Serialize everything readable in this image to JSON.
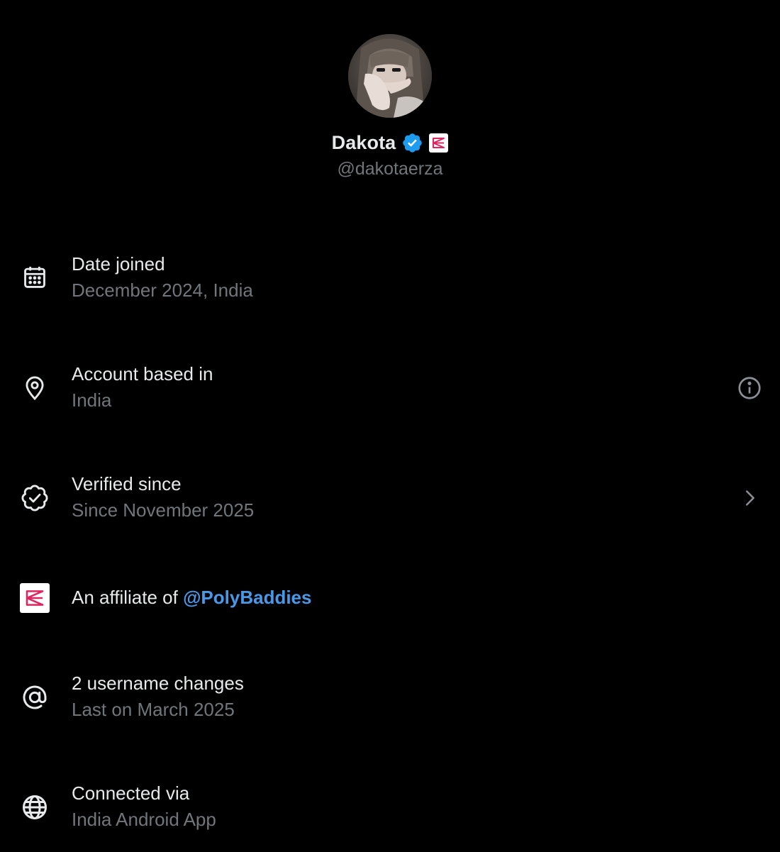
{
  "profile": {
    "display_name": "Dakota",
    "handle": "@dakotaerza",
    "avatar_icon": "avatar-photo",
    "verified_color": "#1d9bf0",
    "affiliate_badge_color": "#e0245e"
  },
  "rows": [
    {
      "icon": "calendar-icon",
      "title": "Date joined",
      "subtitle": "December 2024, India"
    },
    {
      "icon": "location-pin-icon",
      "title": "Account based in",
      "subtitle": "India",
      "action_icon": "info-icon"
    },
    {
      "icon": "verified-outline-icon",
      "title": "Verified since",
      "subtitle": "Since November 2025",
      "action_icon": "chevron-right-icon"
    },
    {
      "icon": "affiliate-badge-icon",
      "title_prefix": "An affiliate of ",
      "title_link": "@PolyBaddies"
    },
    {
      "icon": "at-sign-icon",
      "title": "2 username changes",
      "subtitle": "Last on March 2025"
    },
    {
      "icon": "globe-icon",
      "title": "Connected via",
      "subtitle": "India Android App"
    }
  ],
  "colors": {
    "background": "#000000",
    "primary_text": "#e7e9ea",
    "secondary_text": "#71767b",
    "link": "#4a99e9"
  }
}
